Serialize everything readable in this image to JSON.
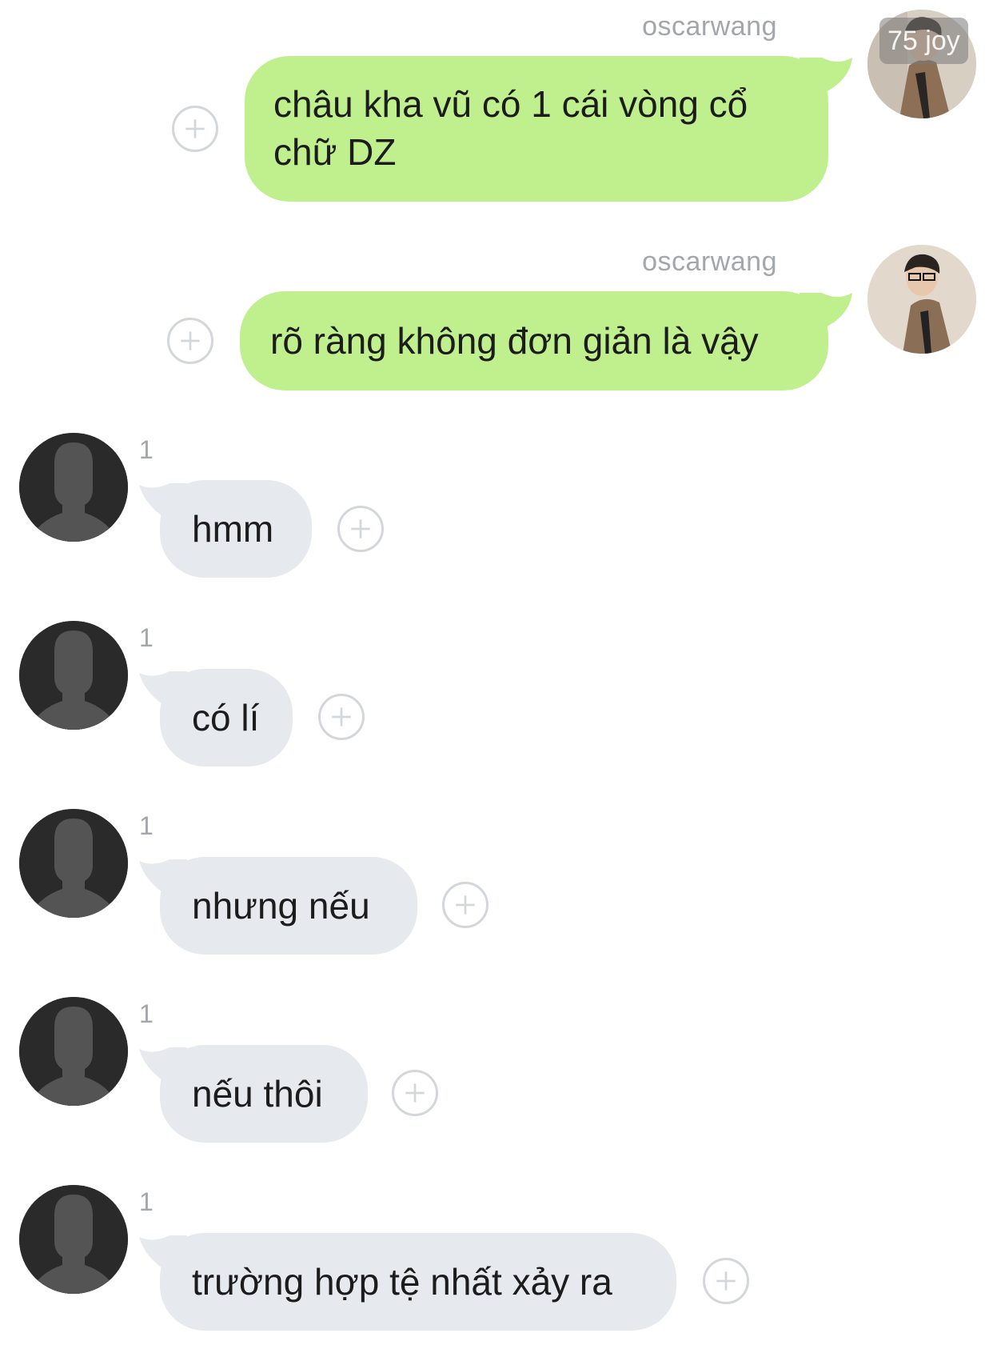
{
  "watermark": "75 joy",
  "messages_out": [
    {
      "sender": "oscarwang",
      "text": "châu kha vũ có 1 cái vòng cổ chữ DZ"
    },
    {
      "sender": "oscarwang",
      "text": "rõ ràng không đơn giản là vậy"
    }
  ],
  "messages_in": [
    {
      "read_count": "1",
      "text": "hmm"
    },
    {
      "read_count": "1",
      "text": "có lí"
    },
    {
      "read_count": "1",
      "text": "nhưng nếu"
    },
    {
      "read_count": "1",
      "text": "nếu thôi"
    },
    {
      "read_count": "1",
      "text": "trường hợp tệ nhất xảy ra"
    }
  ],
  "colors": {
    "outgoing_bubble": "#c0f08e",
    "incoming_bubble": "#e6e9ed",
    "meta_text": "#a3a6ab"
  },
  "icons": {
    "plus": "plus-circle-icon",
    "default_avatar": "person-silhouette-icon"
  }
}
